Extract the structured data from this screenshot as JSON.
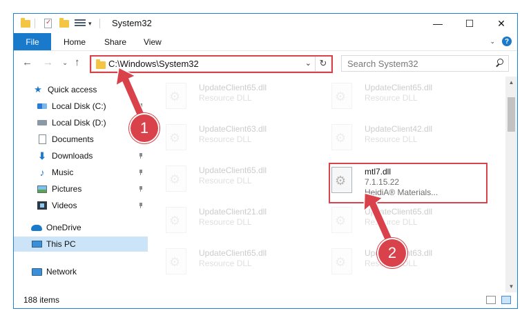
{
  "window": {
    "title": "System32"
  },
  "ribbon": {
    "tabs": [
      "File",
      "Home",
      "Share",
      "View"
    ],
    "help": "?"
  },
  "address": {
    "path": "C:\\Windows\\System32"
  },
  "search": {
    "placeholder": "Search System32"
  },
  "sidebar": {
    "items": [
      {
        "label": "Quick access",
        "icon": "star-icon"
      },
      {
        "label": "Local Disk (C:)",
        "icon": "local-disk-icon"
      },
      {
        "label": "Local Disk (D:)",
        "icon": "local-disk-icon"
      },
      {
        "label": "Documents",
        "icon": "documents-icon"
      },
      {
        "label": "Downloads",
        "icon": "downloads-icon"
      },
      {
        "label": "Music",
        "icon": "music-icon"
      },
      {
        "label": "Pictures",
        "icon": "pictures-icon"
      },
      {
        "label": "Videos",
        "icon": "videos-icon"
      },
      {
        "label": "OneDrive",
        "icon": "onedrive-icon"
      },
      {
        "label": "This PC",
        "icon": "this-pc-icon"
      },
      {
        "label": "Network",
        "icon": "network-icon"
      }
    ]
  },
  "files": [
    {
      "name": "UpdateClient65.dll",
      "type": "Resource DLL"
    },
    {
      "name": "UpdateClient65.dll",
      "type": "Resource DLL"
    },
    {
      "name": "UpdateClient63.dll",
      "type": "Resource DLL"
    },
    {
      "name": "UpdateClient42.dll",
      "type": "Resource DLL"
    },
    {
      "name": "UpdateClient65.dll",
      "type": "Resource DLL"
    },
    {
      "name": "mtl7.dll",
      "version": "7.1.15.22",
      "company": "HeidiA® Materials..."
    },
    {
      "name": "UpdateClient21.dll",
      "type": "Resource DLL"
    },
    {
      "name": "UpdateClient65.dll",
      "type": "Resource DLL"
    },
    {
      "name": "UpdateClient65.dll",
      "type": "Resource DLL"
    },
    {
      "name": "UpdateClient63.dll",
      "type": "Resource DLL"
    }
  ],
  "status": {
    "count": "188 items"
  },
  "callouts": [
    "1",
    "2"
  ],
  "colors": {
    "accent": "#1979ca",
    "highlight": "#d9424a",
    "selected": "#cce4f7"
  }
}
